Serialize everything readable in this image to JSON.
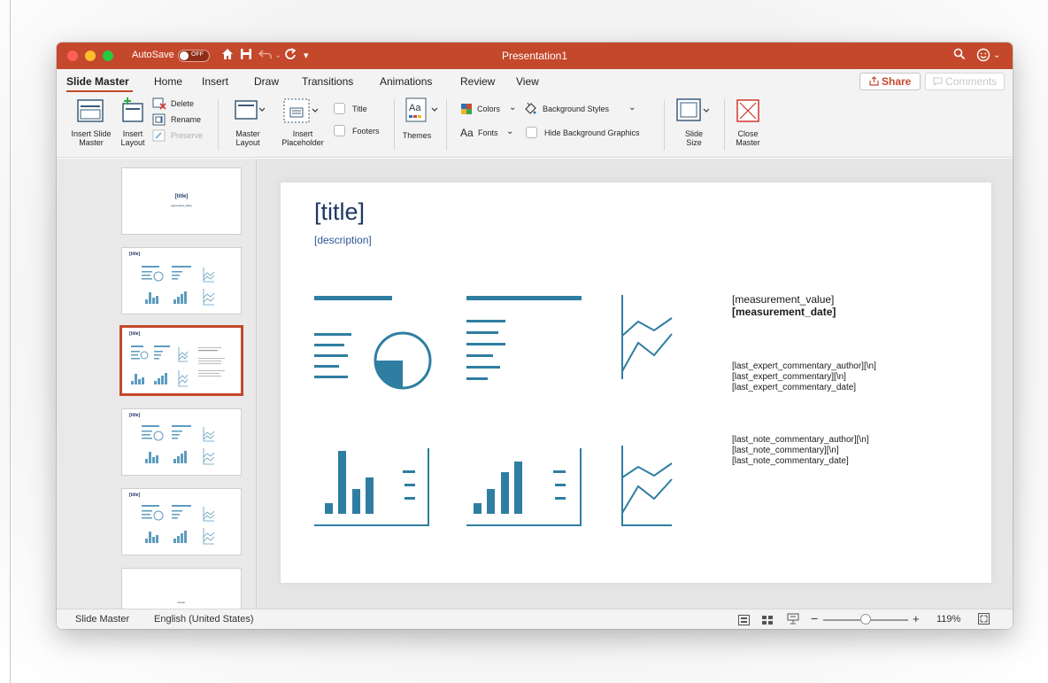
{
  "window": {
    "title": "Presentation1",
    "autosave_label": "AutoSave",
    "autosave_state": "OFF"
  },
  "ribbon_tabs": [
    {
      "label": "Slide Master",
      "active": true
    },
    {
      "label": "Home"
    },
    {
      "label": "Insert"
    },
    {
      "label": "Draw"
    },
    {
      "label": "Transitions"
    },
    {
      "label": "Animations"
    },
    {
      "label": "Review"
    },
    {
      "label": "View"
    }
  ],
  "share_label": "Share",
  "comments_label": "Comments",
  "ribbon": {
    "insert_slide_master": [
      "Insert Slide",
      "Master"
    ],
    "insert_layout": [
      "Insert",
      "Layout"
    ],
    "delete": "Delete",
    "rename": "Rename",
    "preserve": "Preserve",
    "master_layout": [
      "Master",
      "Layout"
    ],
    "insert_placeholder": [
      "Insert",
      "Placeholder"
    ],
    "title_check": "Title",
    "footers_check": "Footers",
    "themes": "Themes",
    "colors": "Colors",
    "background_styles": "Background Styles",
    "fonts": "Fonts",
    "hide_background": "Hide Background Graphics",
    "slide_size": [
      "Slide",
      "Size"
    ],
    "close_master": [
      "Close",
      "Master"
    ]
  },
  "thumbnails": [
    {
      "title": "[title]",
      "subtitle": "[generated_slide]"
    },
    {
      "title": "[title]"
    },
    {
      "title": "[title]",
      "selected": true
    },
    {
      "title": "[title]"
    },
    {
      "title": "[title]"
    },
    {
      "title": "Footer"
    }
  ],
  "slide": {
    "title": "[title]",
    "description": "[description]",
    "measurement_value": "[measurement_value]",
    "measurement_date": "[measurement_date]",
    "expert_lines": [
      "[last_expert_commentary_author][\\n]",
      "[last_expert_commentary][\\n]",
      "[last_expert_commentary_date]"
    ],
    "note_lines": [
      "[last_note_commentary_author][\\n]",
      "[last_note_commentary][\\n]",
      "[last_note_commentary_date]"
    ]
  },
  "statusbar": {
    "view": "Slide Master",
    "language": "English (United States)",
    "zoom": "119%",
    "zoom_level": 0.5
  },
  "colors": {
    "accent": "#c4482b",
    "icon_blue": "#2f7ea1",
    "title_blue": "#1f3864"
  }
}
